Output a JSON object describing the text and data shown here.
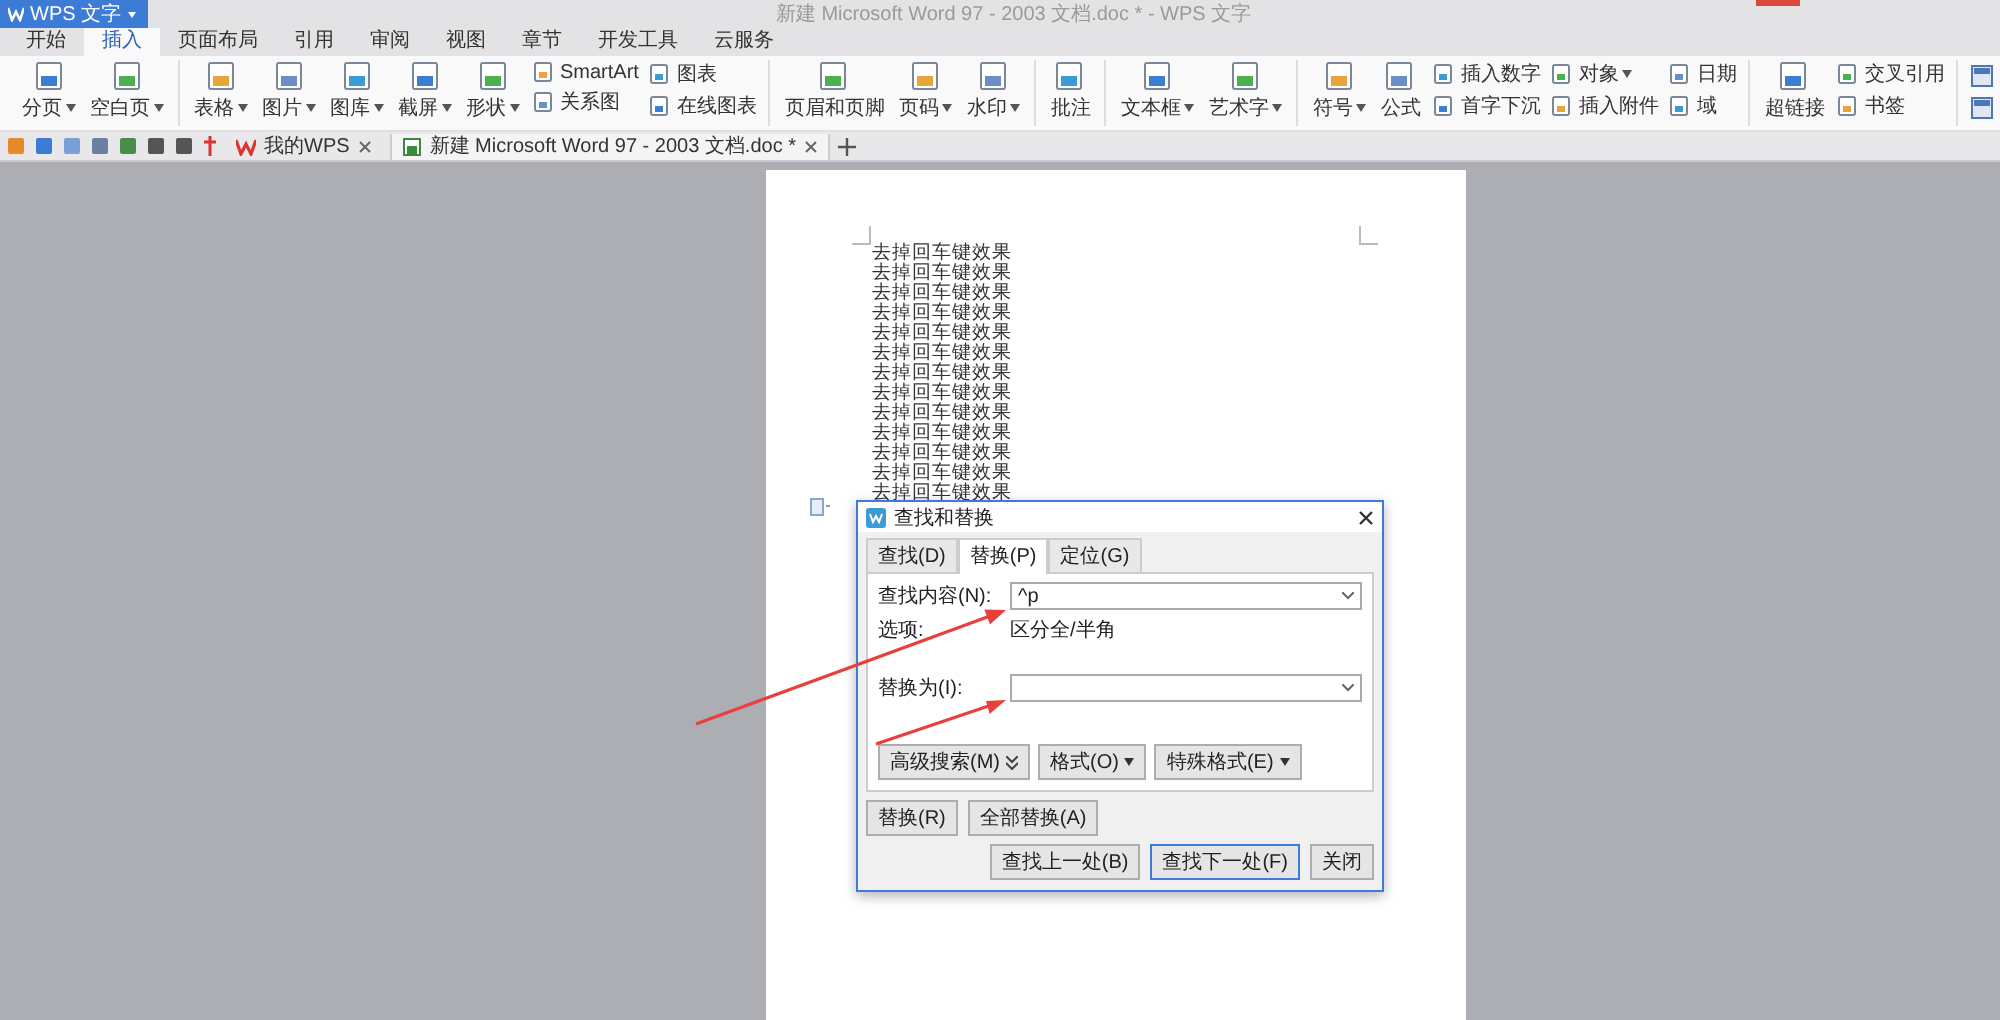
{
  "title_bar": {
    "app_button": "WPS 文字",
    "title": "新建 Microsoft Word 97 - 2003 文档.doc * - WPS 文字"
  },
  "menu_tabs": [
    {
      "label": "开始",
      "selected": false
    },
    {
      "label": "插入",
      "selected": true
    },
    {
      "label": "页面布局",
      "selected": false
    },
    {
      "label": "引用",
      "selected": false
    },
    {
      "label": "审阅",
      "selected": false
    },
    {
      "label": "视图",
      "selected": false
    },
    {
      "label": "章节",
      "selected": false
    },
    {
      "label": "开发工具",
      "selected": false
    },
    {
      "label": "云服务",
      "selected": false
    }
  ],
  "ribbon": {
    "groups": [
      {
        "columns": [
          {
            "kind": "large",
            "label": "分页",
            "dropdown": true
          },
          {
            "kind": "large",
            "label": "空白页",
            "dropdown": true
          }
        ]
      },
      {
        "columns": [
          {
            "kind": "large",
            "label": "表格",
            "dropdown": true
          },
          {
            "kind": "large",
            "label": "图片",
            "dropdown": true
          },
          {
            "kind": "large",
            "label": "图库",
            "dropdown": true
          },
          {
            "kind": "large",
            "label": "截屏",
            "dropdown": true
          },
          {
            "kind": "large",
            "label": "形状",
            "dropdown": true
          },
          {
            "kind": "stack",
            "items": [
              {
                "label": "SmartArt",
                "dropdown": false
              },
              {
                "label": "关系图",
                "dropdown": false
              }
            ]
          },
          {
            "kind": "stack",
            "items": [
              {
                "label": "图表",
                "dropdown": false
              },
              {
                "label": "在线图表",
                "dropdown": false
              }
            ]
          }
        ]
      },
      {
        "columns": [
          {
            "kind": "large",
            "label": "页眉和页脚",
            "dropdown": false
          },
          {
            "kind": "large",
            "label": "页码",
            "dropdown": true
          },
          {
            "kind": "large",
            "label": "水印",
            "dropdown": true
          }
        ]
      },
      {
        "columns": [
          {
            "kind": "large",
            "label": "批注",
            "dropdown": false
          }
        ]
      },
      {
        "columns": [
          {
            "kind": "large",
            "label": "文本框",
            "dropdown": true
          },
          {
            "kind": "large",
            "label": "艺术字",
            "dropdown": true
          }
        ]
      },
      {
        "columns": [
          {
            "kind": "large",
            "label": "符号",
            "dropdown": true
          },
          {
            "kind": "large",
            "label": "公式",
            "dropdown": false
          },
          {
            "kind": "stack",
            "items": [
              {
                "label": "插入数字",
                "dropdown": false
              },
              {
                "label": "首字下沉",
                "dropdown": false
              }
            ]
          },
          {
            "kind": "stack",
            "items": [
              {
                "label": "对象",
                "dropdown": true
              },
              {
                "label": "插入附件",
                "dropdown": false
              }
            ]
          },
          {
            "kind": "stack",
            "items": [
              {
                "label": "日期",
                "dropdown": false
              },
              {
                "label": "域",
                "dropdown": false
              }
            ]
          }
        ]
      },
      {
        "columns": [
          {
            "kind": "large",
            "label": "超链接",
            "dropdown": false
          },
          {
            "kind": "stack",
            "items": [
              {
                "label": "交叉引用",
                "dropdown": false
              },
              {
                "label": "书签",
                "dropdown": false
              }
            ]
          }
        ]
      }
    ]
  },
  "doc_tabs": [
    {
      "label": "我的WPS",
      "selected": false
    },
    {
      "label": "新建 Microsoft Word 97 - 2003 文档.doc *",
      "selected": true
    }
  ],
  "document": {
    "lines": [
      "去掉回车键效果",
      "去掉回车键效果",
      "去掉回车键效果",
      "去掉回车键效果",
      "去掉回车键效果",
      "去掉回车键效果",
      "去掉回车键效果",
      "去掉回车键效果",
      "去掉回车键效果",
      "去掉回车键效果",
      "去掉回车键效果",
      "去掉回车键效果",
      "去掉回车键效果"
    ]
  },
  "dialog": {
    "title": "查找和替换",
    "tabs": [
      {
        "label": "查找(D)",
        "selected": false
      },
      {
        "label": "替换(P)",
        "selected": true
      },
      {
        "label": "定位(G)",
        "selected": false
      }
    ],
    "find_field": {
      "label": "查找内容(N):",
      "value": "^p"
    },
    "options": {
      "label": "选项:",
      "value": "区分全/半角"
    },
    "replace_field": {
      "label": "替换为(I):"
    },
    "option_buttons": [
      {
        "label": "高级搜索(M)",
        "kind": "expand"
      },
      {
        "label": "格式(O)",
        "kind": "menu"
      },
      {
        "label": "特殊格式(E)",
        "kind": "menu"
      }
    ],
    "action_buttons": [
      "替换(R)",
      "全部替换(A)"
    ],
    "footer_buttons": [
      {
        "label": "查找上一处(B)",
        "selected": false
      },
      {
        "label": "查找下一处(F)",
        "selected": true
      },
      {
        "label": "关闭",
        "selected": false
      }
    ]
  }
}
